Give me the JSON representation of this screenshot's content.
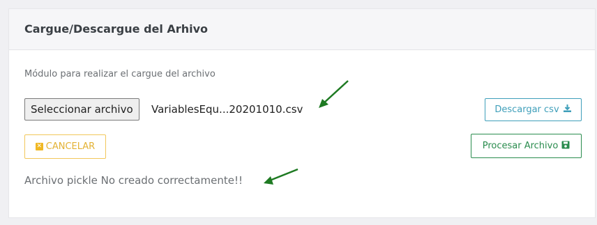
{
  "panel": {
    "title": "Cargue/Descargue del Arhivo",
    "description": "Módulo para realizar el cargue del archivo"
  },
  "file_input": {
    "button_label": "Seleccionar archivo",
    "file_name": "VariablesEqu...20201010.csv"
  },
  "buttons": {
    "download_label": "Descargar csv",
    "download_icon": "download-icon",
    "cancel_label": "CANCELAR",
    "cancel_icon": "close-square-icon",
    "process_label": "Procesar Archivo",
    "process_icon": "save-icon"
  },
  "status_message": "Archivo pickle No creado correctamente!!",
  "annotations": {
    "arrow_color": "#1e7a22"
  },
  "colors": {
    "info": "#3f9fba",
    "success": "#2a8c4e",
    "warning": "#f0b824"
  }
}
